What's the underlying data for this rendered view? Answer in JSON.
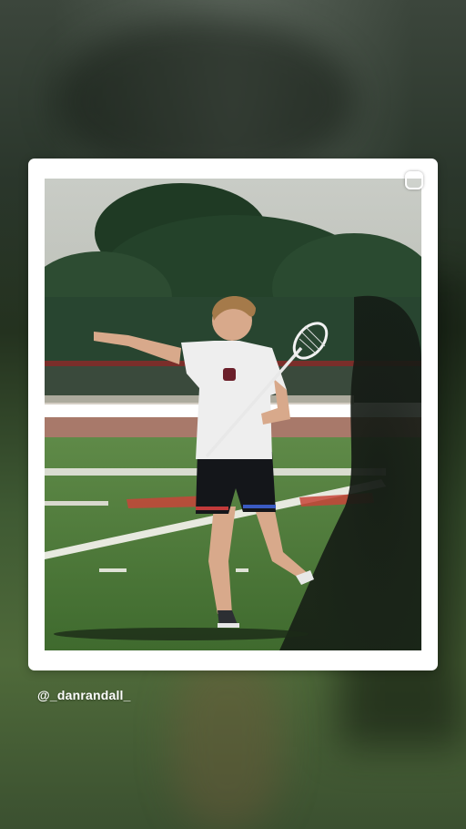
{
  "story": {
    "username": "@_danrandall_"
  },
  "icons": {
    "corner_handle": "rounded-square-handle-icon"
  },
  "colors": {
    "card_background": "#ffffff",
    "text": "#ffffff"
  }
}
